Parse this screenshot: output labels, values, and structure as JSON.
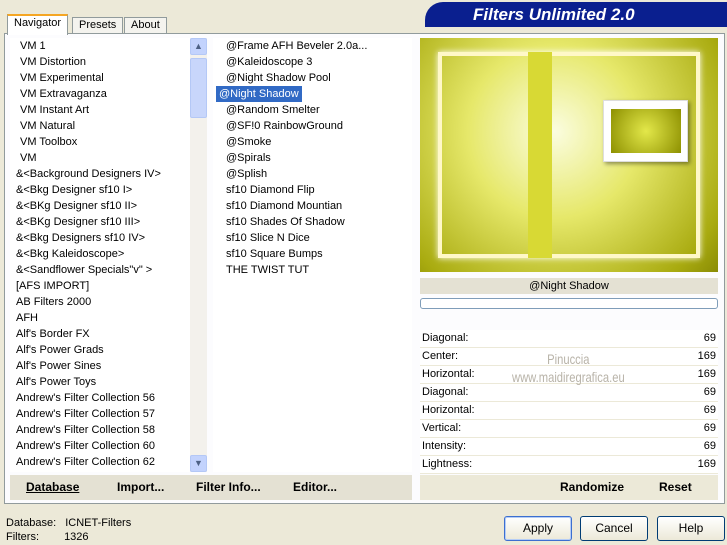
{
  "header": {
    "title": "Filters Unlimited 2.0"
  },
  "tabs": [
    {
      "label": "Navigator",
      "active": true
    },
    {
      "label": "Presets"
    },
    {
      "label": "About"
    }
  ],
  "categories": [
    "VM 1",
    "VM Distortion",
    "VM Experimental",
    "VM Extravaganza",
    "VM Instant Art",
    "VM Natural",
    "VM Toolbox",
    "VM",
    "&<Background Designers IV>",
    "&<Bkg Designer sf10 I>",
    "&<BKg Designer sf10 II>",
    "&<BKg Designer sf10 III>",
    "&<Bkg Designers sf10 IV>",
    "&<Bkg Kaleidoscope>",
    "&<Sandflower Specials\"v\" >",
    "[AFS IMPORT]",
    "AB Filters 2000",
    "AFH",
    "Alf's Border FX",
    "Alf's Power Grads",
    "Alf's Power Sines",
    "Alf's Power Toys",
    "Andrew's Filter Collection 56",
    "Andrew's Filter Collection 57",
    "Andrew's Filter Collection 58",
    "Andrew's Filter Collection 60",
    "Andrew's Filter Collection 62"
  ],
  "filters": [
    "@Frame AFH Beveler 2.0a...",
    "@Kaleidoscope 3",
    "@Night Shadow Pool",
    "@Night Shadow",
    "@Random Smelter",
    "@SF!0 RainbowGround",
    "@Smoke",
    "@Spirals",
    "@Splish",
    "sf10 Diamond Flip",
    "sf10 Diamond Mountian",
    "sf10 Shades Of Shadow",
    "sf10 Slice N Dice",
    "sf10 Square Bumps",
    "THE TWIST TUT"
  ],
  "selected_filter_index": 3,
  "toolbar": {
    "database": "Database",
    "import": "Import...",
    "filter_info": "Filter Info...",
    "editor": "Editor..."
  },
  "preview": {
    "filter_name": "@Night Shadow",
    "progress": 0,
    "watermark": [
      "Pinuccia",
      "www.maidiregrafica.eu"
    ]
  },
  "params": [
    {
      "label": "Diagonal:",
      "value": "69"
    },
    {
      "label": "Center:",
      "value": "169"
    },
    {
      "label": "Horizontal:",
      "value": "169"
    },
    {
      "label": "Diagonal:",
      "value": "69"
    },
    {
      "label": "Horizontal:",
      "value": "69"
    },
    {
      "label": "Vertical:",
      "value": "69"
    },
    {
      "label": "Intensity:",
      "value": "69"
    },
    {
      "label": "Lightness:",
      "value": "169"
    }
  ],
  "actions": {
    "randomize": "Randomize",
    "reset": "Reset"
  },
  "status": {
    "database_label": "Database:",
    "database_value": "ICNET-Filters",
    "filters_label": "Filters:",
    "filters_value": "1326"
  },
  "buttons": {
    "apply": "Apply",
    "cancel": "Cancel",
    "help": "Help"
  }
}
